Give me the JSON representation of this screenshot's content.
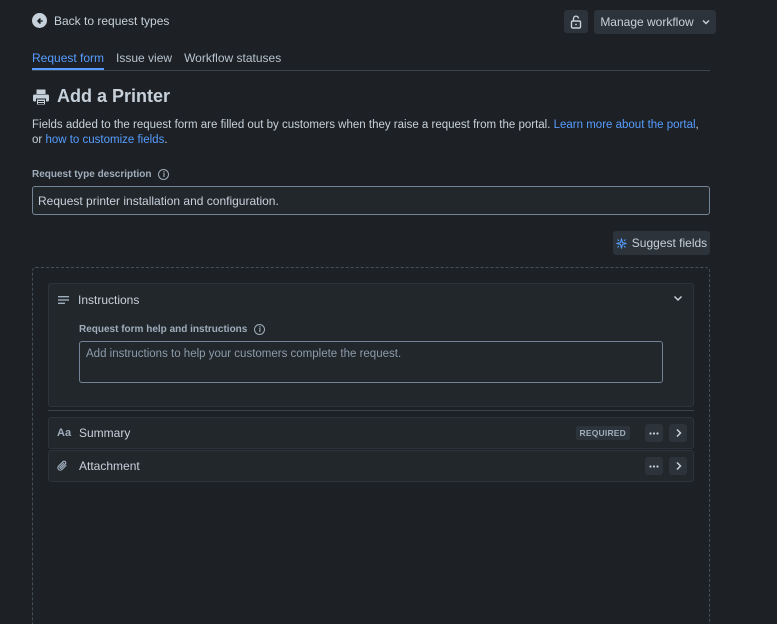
{
  "nav": {
    "back_label": "Back to request types",
    "manage_label": "Manage workflow"
  },
  "tabs": [
    {
      "label": "Request form",
      "active": true
    },
    {
      "label": "Issue view",
      "active": false
    },
    {
      "label": "Workflow statuses",
      "active": false
    }
  ],
  "page": {
    "title": "Add a Printer",
    "description_text": "Fields added to the request form are filled out by customers when they raise a request from the portal.",
    "learn_more_link": "Learn more about the portal",
    "conjunction": ", or",
    "customize_link": "how to customize fields",
    "period": "."
  },
  "request_type_description": {
    "label": "Request type description",
    "value": "Request printer installation and configuration."
  },
  "suggest_fields_label": "Suggest fields",
  "instructions": {
    "header": "Instructions",
    "label": "Request form help and instructions",
    "placeholder": "Add instructions to help your customers complete the request."
  },
  "fields": [
    {
      "icon": "text-field-icon",
      "icon_glyph": "Aa",
      "label": "Summary",
      "badge": "REQUIRED"
    },
    {
      "icon": "paperclip-icon",
      "label": "Attachment"
    }
  ],
  "colors": {
    "background": "#1d2125",
    "accent": "#579dff",
    "card": "#22272b",
    "button": "#2c333a"
  }
}
